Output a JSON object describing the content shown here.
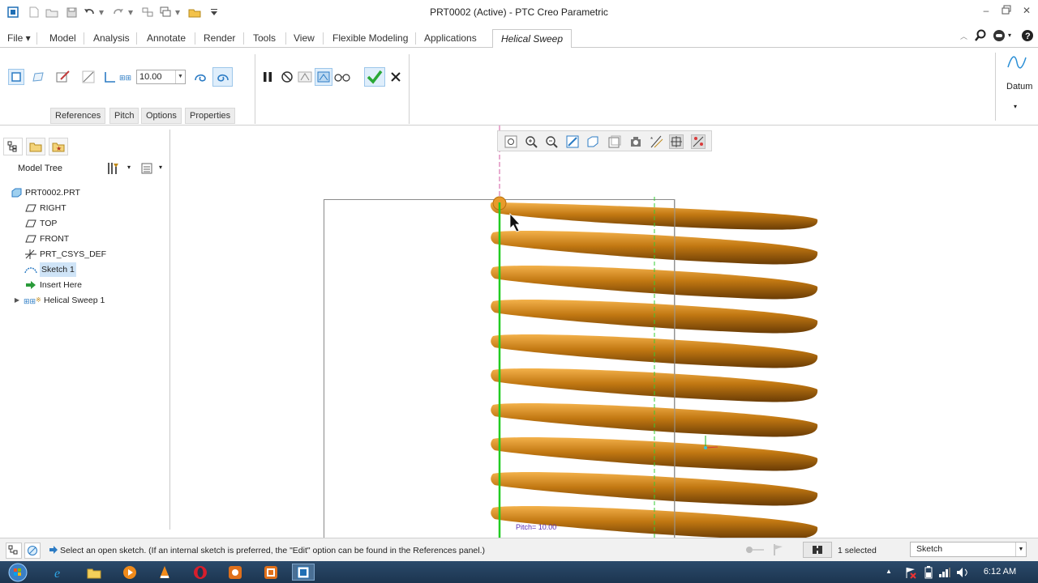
{
  "window": {
    "title": "PRT0002 (Active) - PTC Creo Parametric"
  },
  "menu": {
    "file": "File ▾",
    "tabs": [
      "Model",
      "Analysis",
      "Annotate",
      "Render",
      "Tools",
      "View",
      "Flexible Modeling",
      "Applications"
    ],
    "active_tab": "Helical Sweep"
  },
  "ribbon": {
    "pitch_value": "10.00",
    "subtabs": [
      "References",
      "Pitch",
      "Options",
      "Properties"
    ],
    "datum_label": "Datum"
  },
  "navigator": {
    "header": "Model Tree",
    "items": [
      {
        "label": "PRT0002.PRT",
        "icon": "part-icon"
      },
      {
        "label": "RIGHT",
        "icon": "datum-plane-icon"
      },
      {
        "label": "TOP",
        "icon": "datum-plane-icon"
      },
      {
        "label": "FRONT",
        "icon": "datum-plane-icon"
      },
      {
        "label": "PRT_CSYS_DEF",
        "icon": "csys-icon"
      },
      {
        "label": "Sketch 1",
        "icon": "sketch-icon"
      },
      {
        "label": "Insert Here",
        "icon": "insert-arrow-icon"
      },
      {
        "label": "Helical Sweep 1",
        "icon": "helical-sweep-icon"
      }
    ]
  },
  "graphics": {
    "pitch_annotation": "Pitch= 10.00"
  },
  "status": {
    "message": "Select an open sketch. (If an internal sketch is preferred, the \"Edit\" option can be found in the References panel.)",
    "selected": "1 selected",
    "filter": "Sketch"
  },
  "taskbar": {
    "time": "6:12 AM"
  },
  "colors": {
    "spring": "#c27812",
    "axis": "#22cc22",
    "accent": "#3b8fd6"
  }
}
